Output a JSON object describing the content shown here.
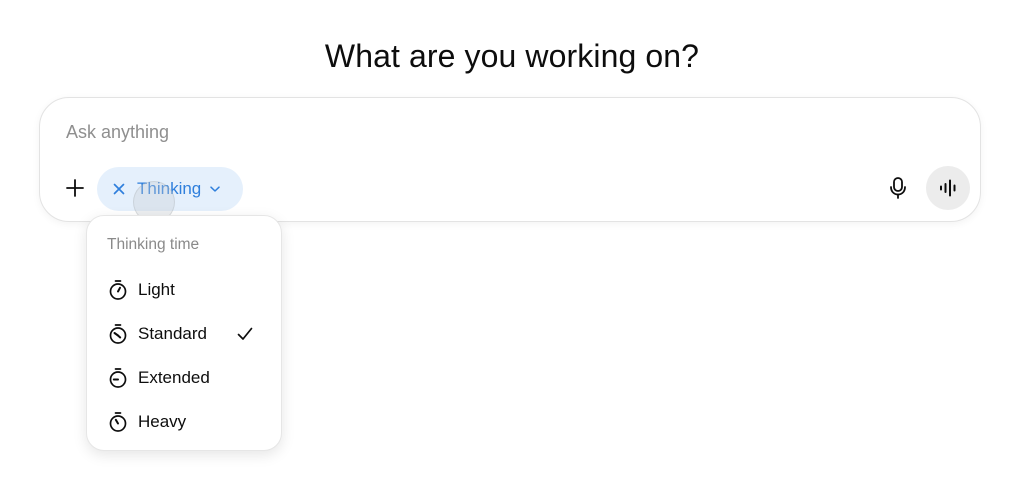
{
  "headline": "What are you working on?",
  "composer": {
    "placeholder": "Ask anything",
    "value": ""
  },
  "toolbar": {
    "add_icon": "plus-icon",
    "mode_pill": {
      "label": "Thinking",
      "remove_icon": "close-icon",
      "dropdown_icon": "chevron-down-icon",
      "color": "#2f7fdc",
      "background": "#e5f0fc"
    },
    "mic_icon": "microphone-icon",
    "voice_icon": "voice-mode-icon"
  },
  "thinking_menu": {
    "header": "Thinking time",
    "selected": "Standard",
    "items": [
      {
        "label": "Light",
        "icon": "stopwatch-light-icon",
        "selected": false
      },
      {
        "label": "Standard",
        "icon": "stopwatch-standard-icon",
        "selected": true
      },
      {
        "label": "Extended",
        "icon": "stopwatch-extended-icon",
        "selected": false
      },
      {
        "label": "Heavy",
        "icon": "stopwatch-heavy-icon",
        "selected": false
      }
    ],
    "check_icon": "checkmark-icon"
  }
}
